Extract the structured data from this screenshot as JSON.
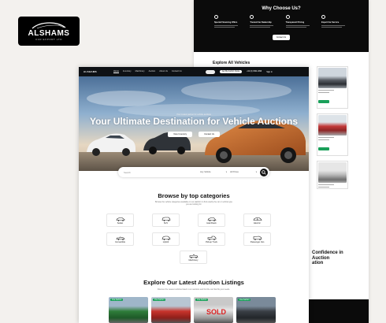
{
  "brand": {
    "name": "ALSHAMS",
    "tagline": "CAR EXPORT LTD"
  },
  "nav": {
    "links": [
      "Home",
      "Inventory",
      "Machinery",
      "Auction",
      "About Us",
      "Contact Us"
    ],
    "cta": "Get My Auction Quote",
    "phone": "+92 (0) 3094-4096",
    "signin": "Sign in"
  },
  "hero": {
    "tagline": "Your trusted partner for vehicle auctions",
    "title": "Your Ultimate Destination for Vehicle Auctions",
    "buttons": [
      "View Inventory",
      "Contact Us"
    ]
  },
  "search": {
    "placeholder": "Search",
    "type_label": "Any Vehicle",
    "price_label": "All Prices"
  },
  "categories": {
    "title": "Browse by top categories",
    "subtitle": "Browse the vehicle categories available on our platform to find exactly the car or vehicle type you are looking for.",
    "items": [
      {
        "label": "Sedan",
        "icon": "sedan-icon"
      },
      {
        "label": "SUV",
        "icon": "suv-icon"
      },
      {
        "label": "Hatchback",
        "icon": "hatchback-icon"
      },
      {
        "label": "Electric",
        "icon": "electric-car-icon"
      },
      {
        "label": "Convertible",
        "icon": "convertible-icon"
      },
      {
        "label": "Hybrid",
        "icon": "hybrid-icon"
      },
      {
        "label": "Pickup Truck",
        "icon": "pickup-truck-icon"
      },
      {
        "label": "Passenger Van",
        "icon": "van-icon"
      },
      {
        "label": "Machinery",
        "icon": "machinery-icon"
      }
    ]
  },
  "latest": {
    "title": "Explore Our Latest Auction Listings",
    "subtitle": "Discover the newest vehicles listed in our auctions and find the car that fits your needs.",
    "badges": [
      "Live Auction",
      "Live Auction",
      "Live Auction",
      "Live Auction"
    ],
    "sold_label": "SOLD"
  },
  "back_page": {
    "why_title": "Why Choose Us?",
    "features": [
      "Special Financing Offers",
      "Trusted Car Dealership",
      "Transparent Pricing",
      "Expert Car Service"
    ],
    "cta": "Contact Us",
    "explore_title": "Explore All Vehicles",
    "heading_lines": [
      "Confidence in",
      "Auction",
      "ation"
    ]
  },
  "colors": {
    "accent": "#1aa05a",
    "dark": "#0b0b0b",
    "car_orange": "#c86a2a"
  }
}
